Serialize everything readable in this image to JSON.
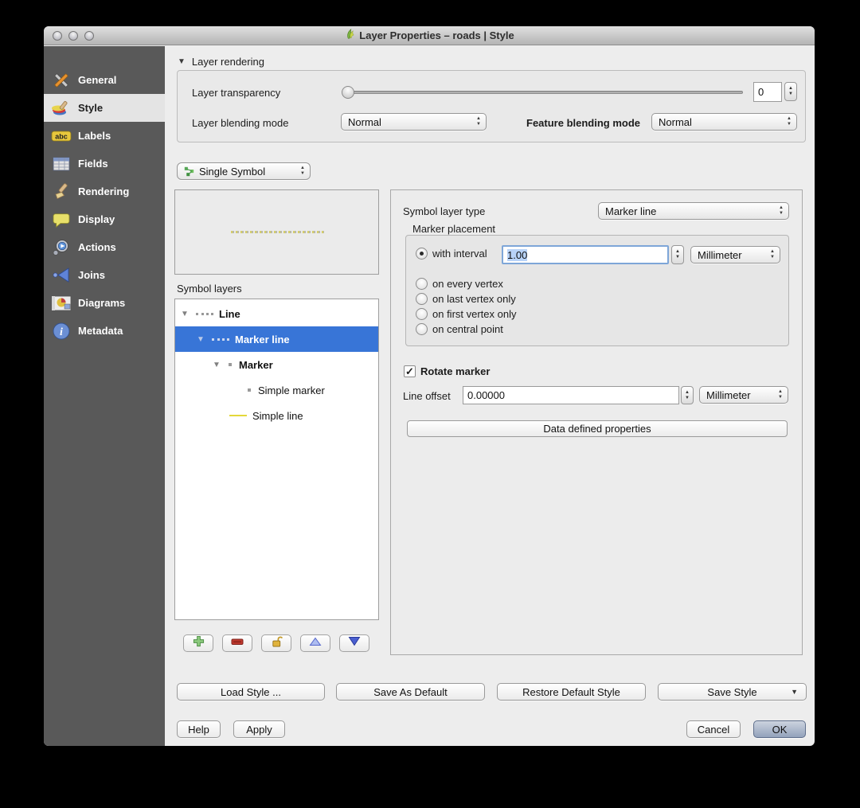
{
  "window": {
    "title": "Layer Properties – roads | Style"
  },
  "sidebar": {
    "items": [
      {
        "label": "General"
      },
      {
        "label": "Style"
      },
      {
        "label": "Labels"
      },
      {
        "label": "Fields"
      },
      {
        "label": "Rendering"
      },
      {
        "label": "Display"
      },
      {
        "label": "Actions"
      },
      {
        "label": "Joins"
      },
      {
        "label": "Diagrams"
      },
      {
        "label": "Metadata"
      }
    ]
  },
  "layer_rendering": {
    "header": "Layer rendering",
    "transparency_label": "Layer transparency",
    "transparency_value": "0",
    "layer_blending_label": "Layer blending mode",
    "layer_blending_value": "Normal",
    "feature_blending_label": "Feature blending mode",
    "feature_blending_value": "Normal"
  },
  "renderer_select": {
    "value": "Single Symbol"
  },
  "symbol": {
    "layers_label": "Symbol layers",
    "tree": [
      {
        "label": "Line"
      },
      {
        "label": "Marker line"
      },
      {
        "label": "Marker"
      },
      {
        "label": "Simple marker"
      },
      {
        "label": "Simple line"
      }
    ]
  },
  "marker_line_panel": {
    "symbol_layer_type_label": "Symbol layer type",
    "symbol_layer_type_value": "Marker line",
    "marker_placement_label": "Marker placement",
    "with_interval_label": "with interval",
    "interval_value": "1.00",
    "interval_unit": "Millimeter",
    "option_every_vertex": "on every vertex",
    "option_last_vertex": "on last vertex only",
    "option_first_vertex": "on first vertex only",
    "option_central_point": "on central point",
    "rotate_marker_label": "Rotate marker",
    "line_offset_label": "Line offset",
    "line_offset_value": "0.00000",
    "line_offset_unit": "Millimeter",
    "data_defined_label": "Data defined properties"
  },
  "style_actions": {
    "load_style": "Load Style ...",
    "save_as_default": "Save As Default",
    "restore_default": "Restore Default Style",
    "save_style": "Save Style"
  },
  "dialog_actions": {
    "help": "Help",
    "apply": "Apply",
    "cancel": "Cancel",
    "ok": "OK"
  },
  "colors": {
    "selection_blue": "#3875d7",
    "sidebar_gray": "#595959",
    "accent_yellow": "#e4d83a"
  }
}
